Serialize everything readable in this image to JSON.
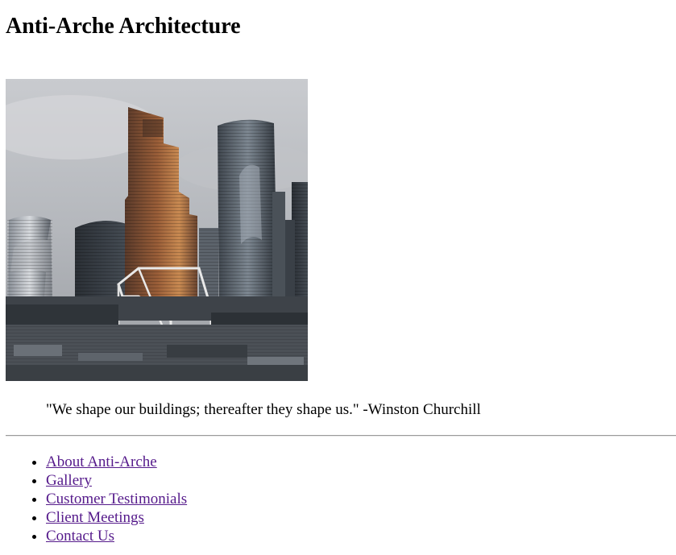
{
  "header": {
    "title": "Anti-Arche Architecture"
  },
  "hero": {
    "image_name": "city-skyline-photo"
  },
  "quote": {
    "text": "\"We shape our buildings; thereafter they shape us.\" -Winston Churchill"
  },
  "nav": {
    "items": [
      {
        "label": "About Anti-Arche"
      },
      {
        "label": "Gallery"
      },
      {
        "label": "Customer Testimonials"
      },
      {
        "label": "Client Meetings"
      },
      {
        "label": "Contact Us"
      }
    ]
  },
  "colors": {
    "visited_link": "#551a8b",
    "text": "#000000",
    "background": "#ffffff"
  }
}
